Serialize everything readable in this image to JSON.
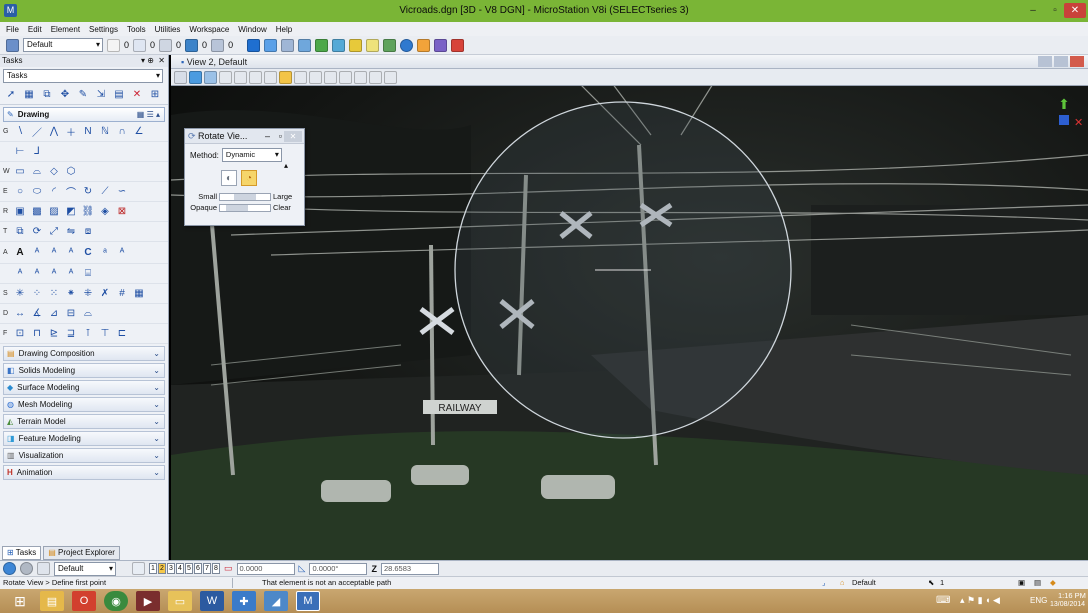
{
  "window": {
    "title": "Vicroads.dgn [3D - V8 DGN] - MicroStation V8i (SELECTseries 3)",
    "min": "–",
    "max": "▫",
    "close": "✕"
  },
  "menu": [
    "File",
    "Edit",
    "Element",
    "Settings",
    "Tools",
    "Utilities",
    "Workspace",
    "Window",
    "Help"
  ],
  "toolbar": {
    "level_select": "Default",
    "num": "0"
  },
  "tasks": {
    "panel_title": "Tasks",
    "combo": "Tasks",
    "drawing_header": "Drawing",
    "rows": [
      "G",
      "",
      "W",
      "E",
      "R",
      "T",
      "A",
      "",
      "S",
      "D",
      "F"
    ],
    "sections": [
      "Drawing Composition",
      "Solids Modeling",
      "Surface Modeling",
      "Mesh Modeling",
      "Terrain Model",
      "Feature Modeling",
      "Visualization",
      "Animation"
    ],
    "bottom_tabs": [
      "Tasks",
      "Project Explorer"
    ]
  },
  "view": {
    "title": "View 2, Default"
  },
  "rotate_dialog": {
    "title": "Rotate Vie...",
    "method_label": "Method:",
    "method_value": "Dynamic",
    "small": "Small",
    "large": "Large",
    "opaque": "Opaque",
    "clear": "Clear"
  },
  "scene": {
    "sign_text": "RAILWAY"
  },
  "coordbar": {
    "level": "Default",
    "views": [
      "1",
      "2",
      "3",
      "4",
      "5",
      "6",
      "7",
      "8"
    ],
    "field1": "0.0000",
    "field2": "0.0000°",
    "z_label": "Z",
    "z_value": "28.6583"
  },
  "status": {
    "prompt": "Rotate View > Define first point",
    "message": "That element is not an acceptable path",
    "level": "Default",
    "scale": "1"
  },
  "taskbar": {
    "lang": "ENG",
    "time": "1:16 PM",
    "date": "13/08/2014"
  },
  "colors": {
    "title_green": "#7ab536",
    "panel_bg": "#eef1f6",
    "taskbar": "#b58e55"
  }
}
